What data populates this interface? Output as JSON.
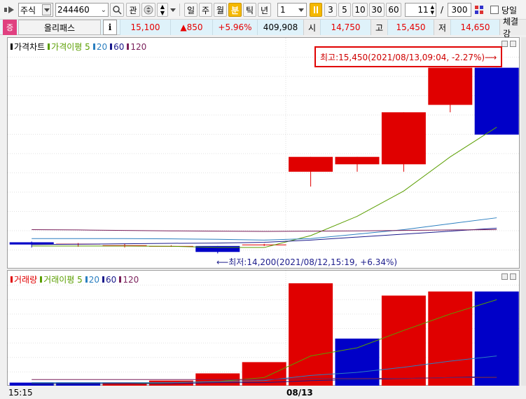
{
  "toolbar": {
    "market": "주식",
    "code": "244460",
    "btn_watch": "관",
    "periods": [
      "일",
      "주",
      "월",
      "분",
      "틱",
      "년"
    ],
    "active_period": "분",
    "interval_value": "1",
    "intervals": [
      "3",
      "5",
      "10",
      "30",
      "60"
    ],
    "count_value": "11",
    "slash": "/",
    "total_value": "300",
    "today_label": "당일"
  },
  "quote": {
    "badge": "증",
    "name": "올리패스",
    "info_button": "i",
    "price": "15,100",
    "change": "▲850",
    "change_pct": "+5.96%",
    "volume": "409,908",
    "open_label": "시",
    "open": "14,750",
    "high_label": "고",
    "high": "15,450",
    "low_label": "저",
    "low": "14,650",
    "trade_label": "체결강"
  },
  "price_panel": {
    "legend_title": "가격차트",
    "legend_ma_label": "가격이평",
    "ma_periods": [
      "5",
      "20",
      "60",
      "120"
    ],
    "max_annotation": "최고:15,450(2021/08/13,09:04, -2.27%)⟶",
    "min_annotation": "⟵최저:14,200(2021/08/12,15:19, +6.34%)"
  },
  "volume_panel": {
    "legend_title": "거래량",
    "legend_ma_label": "거래이평",
    "ma_periods": [
      "5",
      "20",
      "60",
      "120"
    ]
  },
  "xaxis": {
    "start_label": "15:15",
    "date_label": "08/13"
  },
  "colors": {
    "up": "#e00000",
    "down": "#0000c8",
    "ma5": "#5a9e00",
    "ma20": "#2b7fc0",
    "ma60": "#1a1a8c",
    "ma120": "#7a1f5a",
    "accent": "#f5b800"
  },
  "chart_data": [
    {
      "type": "candlestick",
      "title": "가격차트",
      "ylim": [
        14150,
        15500
      ],
      "bars": [
        {
          "o": 14275,
          "h": 14280,
          "l": 14240,
          "c": 14260
        },
        {
          "o": 14265,
          "h": 14270,
          "l": 14245,
          "c": 14265
        },
        {
          "o": 14255,
          "h": 14265,
          "l": 14240,
          "c": 14255
        },
        {
          "o": 14250,
          "h": 14255,
          "l": 14245,
          "c": 14250
        },
        {
          "o": 14250,
          "h": 14250,
          "l": 14200,
          "c": 14210
        },
        {
          "o": 14260,
          "h": 14265,
          "l": 14250,
          "c": 14260
        },
        {
          "o": 14750,
          "h": 14850,
          "l": 14650,
          "c": 14850
        },
        {
          "o": 14800,
          "h": 14850,
          "l": 14750,
          "c": 14850
        },
        {
          "o": 14800,
          "h": 15150,
          "l": 14750,
          "c": 15150
        },
        {
          "o": 15200,
          "h": 15450,
          "l": 15150,
          "c": 15450
        },
        {
          "o": 15450,
          "h": 15450,
          "l": 15000,
          "c": 15000
        }
      ],
      "ma": {
        "5": [
          14250,
          14250,
          14250,
          14248,
          14240,
          14240,
          14320,
          14450,
          14620,
          14850,
          15050
        ],
        "20": [
          14300,
          14300,
          14300,
          14298,
          14295,
          14290,
          14300,
          14330,
          14360,
          14400,
          14440
        ],
        "60": [
          14260,
          14262,
          14265,
          14268,
          14270,
          14275,
          14290,
          14310,
          14330,
          14350,
          14370
        ],
        "120": [
          14360,
          14358,
          14355,
          14352,
          14350,
          14348,
          14350,
          14352,
          14355,
          14358,
          14360
        ]
      }
    },
    {
      "type": "bar",
      "title": "거래량",
      "ylim": [
        0,
        100
      ],
      "values": [
        3,
        3,
        3,
        5,
        12,
        23,
        100,
        46,
        88,
        92,
        92
      ],
      "directions": [
        "down",
        "down",
        "up",
        "up",
        "up",
        "up",
        "up",
        "down",
        "up",
        "up",
        "down"
      ],
      "ma": {
        "5": [
          2,
          2,
          2,
          3,
          4,
          8,
          29,
          37,
          54,
          70,
          84
        ],
        "20": [
          3,
          3,
          3,
          3,
          4,
          5,
          10,
          13,
          18,
          24,
          29
        ],
        "60": [
          2,
          2,
          2,
          2,
          3,
          3,
          5,
          6,
          7,
          8,
          9
        ],
        "120": [
          6,
          6,
          6,
          6,
          6,
          6,
          7,
          7,
          7,
          8,
          8
        ]
      }
    }
  ]
}
